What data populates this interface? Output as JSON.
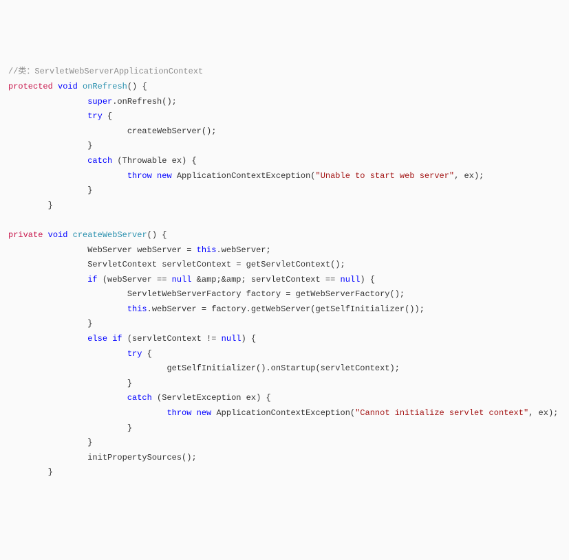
{
  "l1": "//类：ServletWebServerApplicationContext",
  "l2a": "protected",
  "l2b": " ",
  "l2c": "void",
  "l2d": " ",
  "l2e": "onRefresh",
  "l2f": "() {",
  "l3a": "                ",
  "l3b": "super",
  "l3c": ".onRefresh();",
  "l4a": "                ",
  "l4b": "try",
  "l4c": " {",
  "l5": "                        createWebServer();",
  "l6": "                }",
  "l7a": "                ",
  "l7b": "catch",
  "l7c": " (Throwable ex) {",
  "l8a": "                        ",
  "l8b": "throw",
  "l8c": " ",
  "l8d": "new",
  "l8e": " ApplicationContextException(",
  "l8f": "\"Unable to start web server\"",
  "l8g": ", ex);",
  "l9": "                }",
  "l10": "        }",
  "blank1": "",
  "l11a": "private",
  "l11b": " ",
  "l11c": "void",
  "l11d": " ",
  "l11e": "createWebServer",
  "l11f": "() {",
  "l12a": "                WebServer webServer = ",
  "l12b": "this",
  "l12c": ".webServer;",
  "l13": "                ServletContext servletContext = getServletContext();",
  "l14a": "                ",
  "l14b": "if",
  "l14c": " (webServer == ",
  "l14d": "null",
  "l14e": " &amp;&amp; servletContext == ",
  "l14f": "null",
  "l14g": ") {",
  "l15": "                        ServletWebServerFactory factory = getWebServerFactory();",
  "l16a": "                        ",
  "l16b": "this",
  "l16c": ".webServer = factory.getWebServer(getSelfInitializer());",
  "l17": "                }",
  "l18a": "                ",
  "l18b": "else",
  "l18c": " ",
  "l18d": "if",
  "l18e": " (servletContext != ",
  "l18f": "null",
  "l18g": ") {",
  "l19a": "                        ",
  "l19b": "try",
  "l19c": " {",
  "l20": "                                getSelfInitializer().onStartup(servletContext);",
  "l21": "                        }",
  "l22a": "                        ",
  "l22b": "catch",
  "l22c": " (ServletException ex) {",
  "l23a": "                                ",
  "l23b": "throw",
  "l23c": " ",
  "l23d": "new",
  "l23e": " ApplicationContextException(",
  "l23f": "\"Cannot initialize servlet context\"",
  "l23g": ", ex);",
  "l24": "                        }",
  "l25": "                }",
  "l26": "                initPropertySources();",
  "l27": "        }"
}
